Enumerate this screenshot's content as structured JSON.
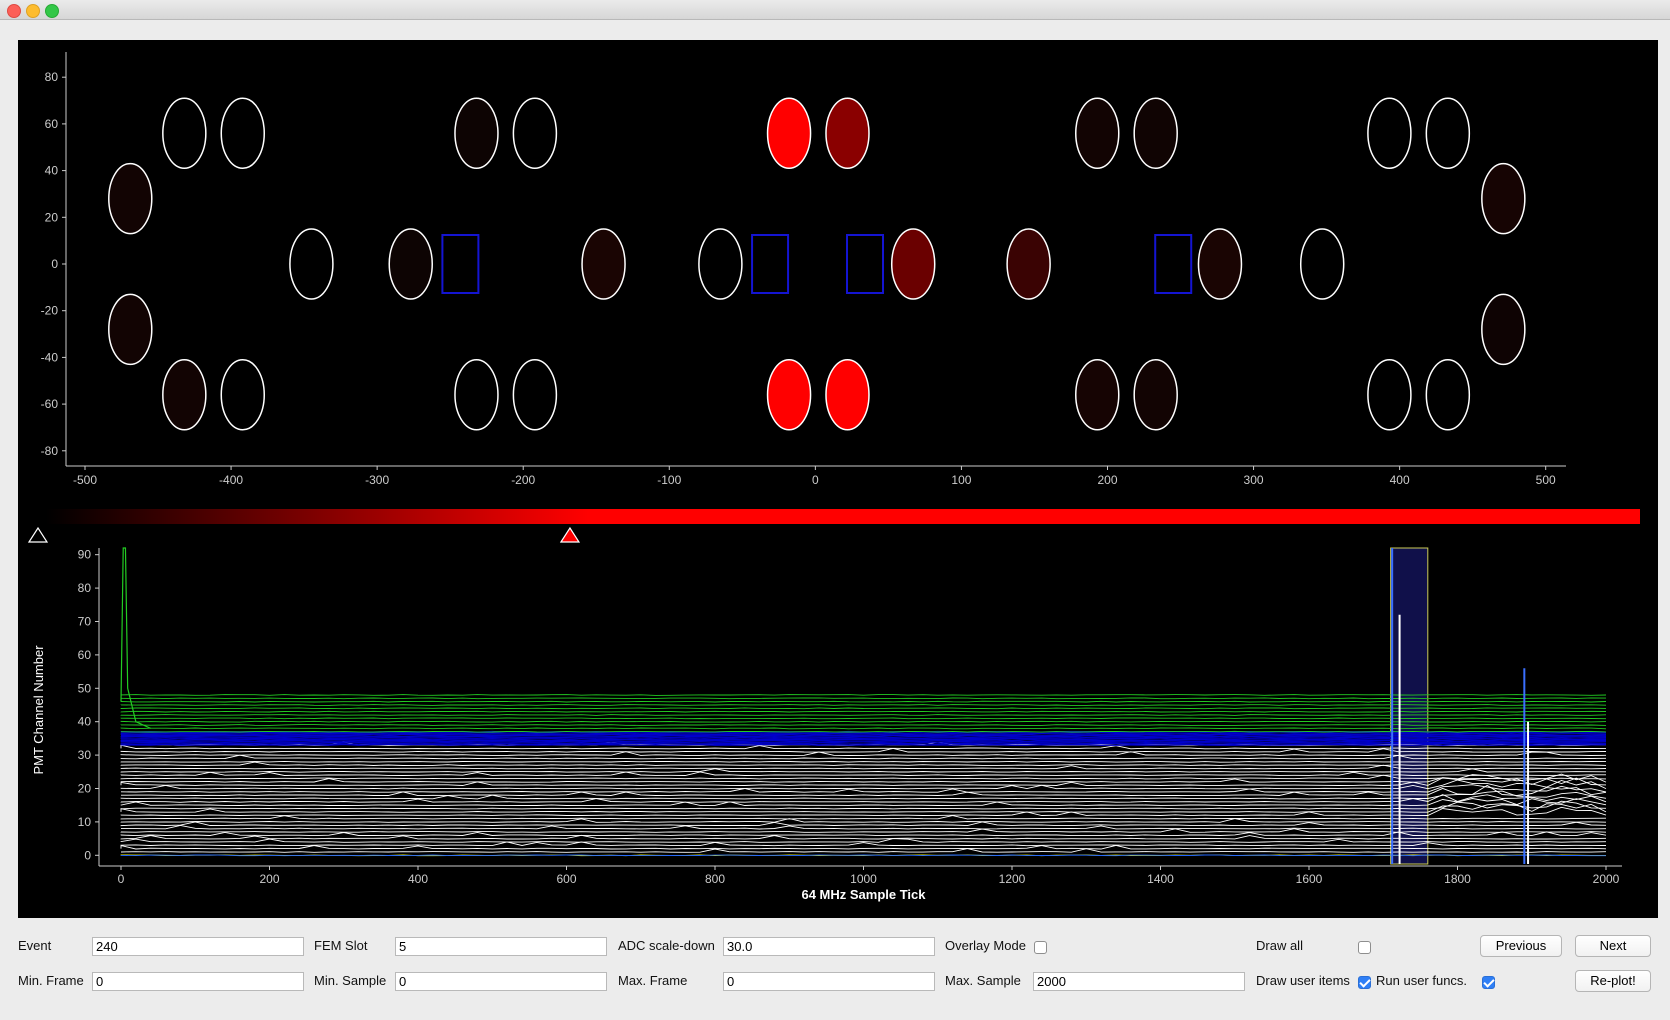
{
  "window": {
    "traffic_lights": [
      "close",
      "minimize",
      "zoom"
    ]
  },
  "detector_view": {
    "x_ticks": [
      "-500",
      "-400",
      "-300",
      "-200",
      "-100",
      "0",
      "100",
      "200",
      "300",
      "400",
      "500"
    ],
    "y_ticks": [
      "80",
      "60",
      "40",
      "20",
      "0",
      "-20",
      "-40",
      "-60",
      "-80"
    ],
    "axis_color": "#cccccc",
    "pmt_outline_color": "#ffffff",
    "box_outline_color": "#1414d2",
    "pmts": [
      {
        "x": -432,
        "y": 56,
        "fill": "#000000"
      },
      {
        "x": -392,
        "y": 56,
        "fill": "#000000"
      },
      {
        "x": -232,
        "y": 56,
        "fill": "#0d0403"
      },
      {
        "x": -192,
        "y": 56,
        "fill": "#000000"
      },
      {
        "x": -18,
        "y": 56,
        "fill": "#ff0000"
      },
      {
        "x": 22,
        "y": 56,
        "fill": "#8a0000"
      },
      {
        "x": 193,
        "y": 56,
        "fill": "#120403"
      },
      {
        "x": 233,
        "y": 56,
        "fill": "#100403"
      },
      {
        "x": 393,
        "y": 56,
        "fill": "#000000"
      },
      {
        "x": 433,
        "y": 56,
        "fill": "#000000"
      },
      {
        "x": -469,
        "y": 28,
        "fill": "#120403"
      },
      {
        "x": 471,
        "y": 28,
        "fill": "#160403"
      },
      {
        "x": -345,
        "y": 0,
        "fill": "#000000"
      },
      {
        "x": -277,
        "y": 0,
        "fill": "#0d0403"
      },
      {
        "x": -145,
        "y": 0,
        "fill": "#1a0503"
      },
      {
        "x": -65,
        "y": 0,
        "fill": "#000000"
      },
      {
        "x": 67,
        "y": 0,
        "fill": "#6a0000"
      },
      {
        "x": 146,
        "y": 0,
        "fill": "#3a0303"
      },
      {
        "x": 277,
        "y": 0,
        "fill": "#1a0503"
      },
      {
        "x": 347,
        "y": 0,
        "fill": "#000000"
      },
      {
        "x": -469,
        "y": -28,
        "fill": "#120403"
      },
      {
        "x": 471,
        "y": -28,
        "fill": "#0e0303"
      },
      {
        "x": -432,
        "y": -56,
        "fill": "#120403"
      },
      {
        "x": -392,
        "y": -56,
        "fill": "#000000"
      },
      {
        "x": -232,
        "y": -56,
        "fill": "#000000"
      },
      {
        "x": -192,
        "y": -56,
        "fill": "#000000"
      },
      {
        "x": -18,
        "y": -56,
        "fill": "#ff0000"
      },
      {
        "x": 22,
        "y": -56,
        "fill": "#ff0000"
      },
      {
        "x": 193,
        "y": -56,
        "fill": "#160403"
      },
      {
        "x": 233,
        "y": -56,
        "fill": "#120403"
      },
      {
        "x": 393,
        "y": -56,
        "fill": "#000000"
      },
      {
        "x": 433,
        "y": -56,
        "fill": "#000000"
      }
    ],
    "boxes": [
      {
        "x": -243,
        "y": 0
      },
      {
        "x": -31,
        "y": 0
      },
      {
        "x": 34,
        "y": 0
      },
      {
        "x": 245,
        "y": 0
      }
    ]
  },
  "color_scale": {
    "min_color": "#000000",
    "max_color": "#ff0000",
    "low_marker_level": 0.0,
    "high_marker_level": 0.34
  },
  "chart_data": {
    "type": "line",
    "title": "",
    "xlabel": "64 MHz Sample Tick",
    "ylabel": "PMT Channel Number",
    "xlim": [
      0,
      2000
    ],
    "ylim": [
      -5,
      92
    ],
    "x_ticks": [
      "0",
      "200",
      "400",
      "600",
      "800",
      "1000",
      "1200",
      "1400",
      "1600",
      "1800",
      "2000"
    ],
    "y_ticks": [
      "0",
      "10",
      "20",
      "30",
      "40",
      "50",
      "60",
      "70",
      "80",
      "90"
    ],
    "series": [
      {
        "color": "#ffffff",
        "channels": [
          1,
          33
        ],
        "baseline": "flat",
        "features": "pulses near tick 1710-1760 on channels 12-30; pulses near tick 1900"
      },
      {
        "color": "#0000cc",
        "channels": [
          33,
          37
        ],
        "baseline": "flat"
      },
      {
        "color": "#22cc22",
        "channels": [
          37,
          48
        ],
        "baseline": "flat",
        "features": "spike to top near tick 5"
      },
      {
        "color": "#ffff00",
        "channels": [
          0,
          0
        ],
        "baseline": "flat"
      },
      {
        "color": "#2266ff",
        "channels": [
          0,
          0
        ],
        "baseline": "flat",
        "features": "spike near tick 1900"
      }
    ],
    "highlight_region": {
      "x_from": 1710,
      "x_to": 1760,
      "fill": "#10104a",
      "border": "#cccc55"
    },
    "vertical_markers": [
      {
        "x": 1712,
        "color": "#3a6fff",
        "height_to": 92
      },
      {
        "x": 1722,
        "color": "#ffffff",
        "height_to": 72
      },
      {
        "x": 1890,
        "color": "#3a6fff",
        "height_to": 56
      },
      {
        "x": 1895,
        "color": "#ffffff",
        "height_to": 40
      }
    ]
  },
  "controls": {
    "event_label": "Event",
    "event_value": "240",
    "fem_slot_label": "FEM Slot",
    "fem_slot_value": "5",
    "adc_label": "ADC scale-down",
    "adc_value": "30.0",
    "overlay_label": "Overlay Mode",
    "overlay_checked": false,
    "draw_all_label": "Draw all",
    "draw_all_checked": false,
    "previous_label": "Previous",
    "next_label": "Next",
    "min_frame_label": "Min. Frame",
    "min_frame_value": "0",
    "min_sample_label": "Min. Sample",
    "min_sample_value": "0",
    "max_frame_label": "Max. Frame",
    "max_frame_value": "0",
    "max_sample_label": "Max. Sample",
    "max_sample_value": "2000",
    "draw_user_items_label": "Draw user items",
    "draw_user_items_checked": true,
    "run_user_funcs_label": "Run user funcs.",
    "run_user_funcs_checked": true,
    "replot_label": "Re-plot!"
  }
}
